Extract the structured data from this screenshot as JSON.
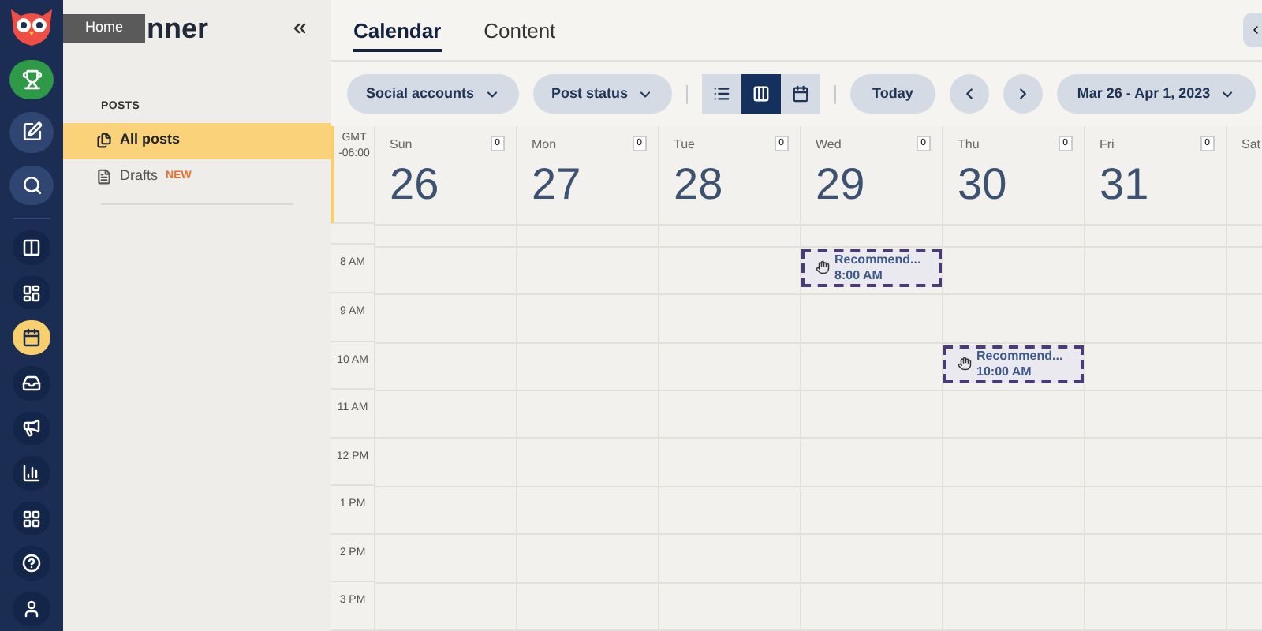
{
  "rail": [
    {
      "kind": "logo"
    },
    {
      "kind": "trophy",
      "selected": false
    },
    {
      "kind": "compose",
      "selected": false
    },
    {
      "kind": "search",
      "selected": false
    },
    {
      "kind": "streams",
      "selected": false
    },
    {
      "kind": "dashboard",
      "selected": false
    },
    {
      "kind": "calendar",
      "selected": true
    },
    {
      "kind": "inbox",
      "selected": false
    },
    {
      "kind": "megaphone",
      "selected": false
    },
    {
      "kind": "analytics",
      "selected": false
    },
    {
      "kind": "apps",
      "selected": false
    },
    {
      "kind": "help",
      "selected": false
    },
    {
      "kind": "avatar",
      "selected": false
    }
  ],
  "tooltip": {
    "text": "Home"
  },
  "sidebar": {
    "title": "nner",
    "section": "POSTS",
    "items": [
      {
        "label": "All posts",
        "selected": true,
        "kind": "all"
      },
      {
        "label": "Drafts",
        "selected": false,
        "kind": "drafts",
        "badge": "NEW"
      }
    ]
  },
  "tabs": [
    {
      "label": "Calendar",
      "selected": true
    },
    {
      "label": "Content",
      "selected": false
    }
  ],
  "toolbar": {
    "filters": [
      "Social accounts",
      "Post status"
    ],
    "views": [
      {
        "kind": "list",
        "selected": false
      },
      {
        "kind": "week",
        "selected": true
      },
      {
        "kind": "month",
        "selected": false
      }
    ],
    "today": "Today",
    "date_range": "Mar 26 - Apr 1, 2023"
  },
  "calendar": {
    "timezone": [
      "GMT",
      "-06:00"
    ],
    "days": [
      {
        "name": "Sun",
        "date": "26",
        "count": "0"
      },
      {
        "name": "Mon",
        "date": "27",
        "count": "0"
      },
      {
        "name": "Tue",
        "date": "28",
        "count": "0"
      },
      {
        "name": "Wed",
        "date": "29",
        "count": "0"
      },
      {
        "name": "Thu",
        "date": "30",
        "count": "0"
      },
      {
        "name": "Fri",
        "date": "31",
        "count": "0"
      },
      {
        "name": "Sat"
      }
    ],
    "hours": [
      "8 AM",
      "9 AM",
      "10 AM",
      "11 AM",
      "12 PM",
      "1 PM",
      "2 PM",
      "3 PM"
    ],
    "events": [
      {
        "title": "Recommend...",
        "time": "8:00 AM"
      },
      {
        "title": "Recommend...",
        "time": "10:00 AM"
      }
    ]
  }
}
